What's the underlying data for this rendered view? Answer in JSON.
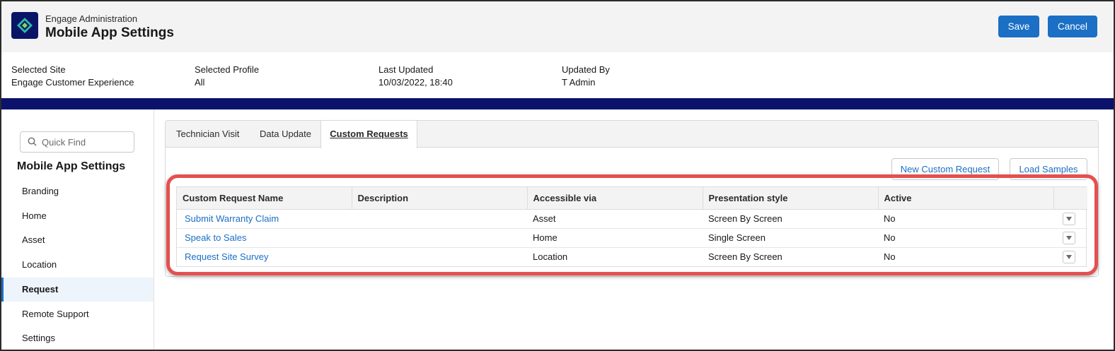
{
  "header": {
    "app_sub": "Engage Administration",
    "title": "Mobile App Settings",
    "save_label": "Save",
    "cancel_label": "Cancel",
    "brand_color": "#1b6fc5",
    "logo_color": "#0b1566"
  },
  "info": {
    "site_label": "Selected Site",
    "site_value": "Engage Customer Experience",
    "profile_label": "Selected Profile",
    "profile_value": "All",
    "updated_label": "Last Updated",
    "updated_value": "10/03/2022, 18:40",
    "by_label": "Updated By",
    "by_value": "T Admin"
  },
  "sidebar": {
    "search_placeholder": "Quick Find",
    "heading": "Mobile App Settings",
    "items": [
      {
        "label": "Branding"
      },
      {
        "label": "Home"
      },
      {
        "label": "Asset"
      },
      {
        "label": "Location"
      },
      {
        "label": "Request",
        "active": true
      },
      {
        "label": "Remote Support"
      },
      {
        "label": "Settings"
      }
    ]
  },
  "tabs": [
    {
      "label": "Technician Visit"
    },
    {
      "label": "Data Update"
    },
    {
      "label": "Custom Requests",
      "active": true
    }
  ],
  "actions": {
    "new_label": "New Custom Request",
    "load_label": "Load Samples"
  },
  "table": {
    "headers": [
      "Custom Request Name",
      "Description",
      "Accessible via",
      "Presentation style",
      "Active"
    ],
    "rows": [
      {
        "name": "Submit Warranty Claim",
        "description": "",
        "accessible": "Asset",
        "style": "Screen By Screen",
        "active": "No"
      },
      {
        "name": "Speak to Sales",
        "description": "",
        "accessible": "Home",
        "style": "Single Screen",
        "active": "No"
      },
      {
        "name": "Request Site Survey",
        "description": "",
        "accessible": "Location",
        "style": "Screen By Screen",
        "active": "No"
      }
    ]
  },
  "highlight_color": "#e45050"
}
